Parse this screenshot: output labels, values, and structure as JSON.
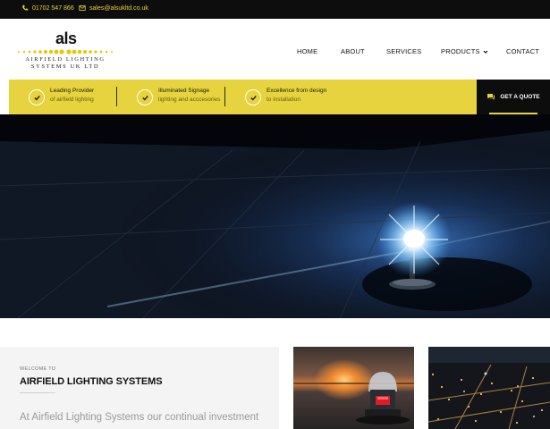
{
  "topbar": {
    "phone": "01702 547 866",
    "email": "sales@alsukltd.co.uk",
    "phone_icon": "phone-icon",
    "email_icon": "envelope-icon"
  },
  "logo": {
    "mark": "als",
    "line1": "AIRFIELD LIGHTING",
    "line2": "SYSTEMS UK LTD"
  },
  "nav": {
    "items": [
      {
        "label": "HOME"
      },
      {
        "label": "ABOUT"
      },
      {
        "label": "SERVICES"
      },
      {
        "label": "PRODUCTS",
        "dropdown": true
      },
      {
        "label": "CONTACT"
      }
    ]
  },
  "features": [
    {
      "title": "Leading Provider",
      "subtitle": "of airfield lighting"
    },
    {
      "title": "Illuminated Signage",
      "subtitle": "lighting and acccesories"
    },
    {
      "title": "Excellence from design",
      "subtitle": "to installation"
    }
  ],
  "quote": {
    "label": "GET A QUOTE",
    "icon": "chat-icon"
  },
  "welcome": {
    "eyebrow": "WELCOME TO",
    "title": "AIRFIELD LIGHTING SYSTEMS",
    "text": "At Airfield Lighting Systems our continual investment"
  },
  "colors": {
    "accent": "#e6d33d",
    "dark": "#0d0d0d",
    "hero_glow": "#8fd4ff"
  }
}
